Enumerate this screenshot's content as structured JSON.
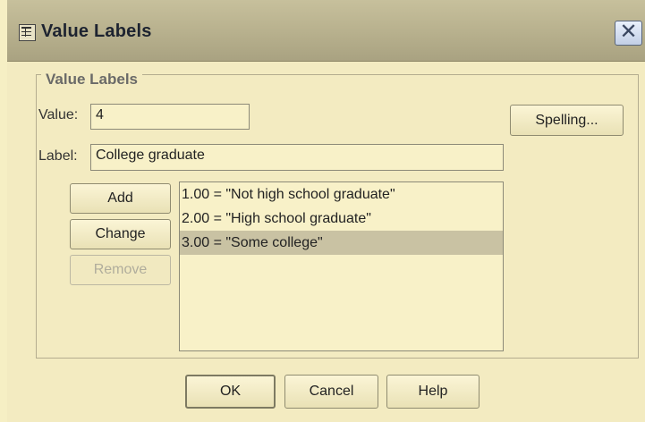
{
  "window": {
    "title": "Value Labels",
    "close_icon": "close-icon",
    "title_icon": "dialog-grid-icon"
  },
  "group": {
    "legend": "Value Labels"
  },
  "value_field": {
    "label": "Value:",
    "value": "4"
  },
  "label_field": {
    "label": "Label:",
    "value": "College graduate"
  },
  "buttons": {
    "spelling": "Spelling...",
    "add": "Add",
    "change": "Change",
    "remove": "Remove",
    "remove_enabled": false
  },
  "labels_list": {
    "items": [
      "1.00 = \"Not high school graduate\"",
      "2.00 = \"High school graduate\"",
      "3.00 = \"Some college\""
    ],
    "selected_index": 2
  },
  "footer": {
    "ok": "OK",
    "cancel": "Cancel",
    "help": "Help"
  },
  "colors": {
    "background": "#f3ebc1",
    "titlebar": "#b7b08d",
    "selection": "#c9c2a3"
  }
}
